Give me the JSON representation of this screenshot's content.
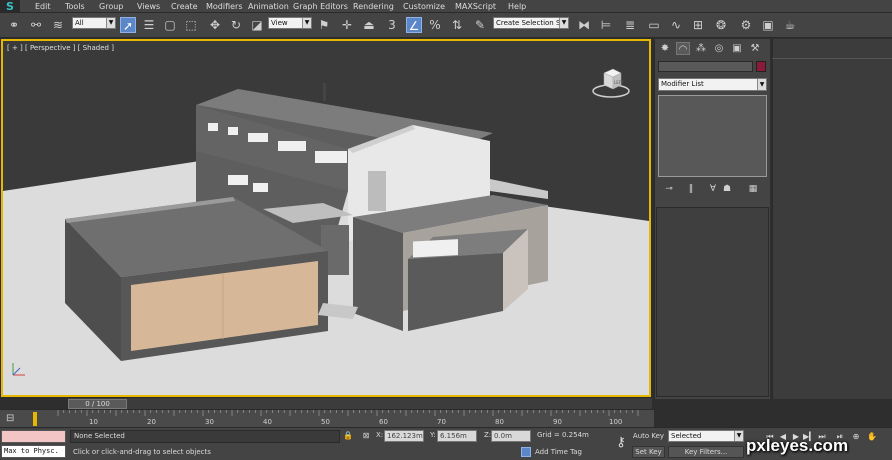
{
  "app": {
    "logo": "S",
    "menus": [
      "Edit",
      "Tools",
      "Group",
      "Views",
      "Create",
      "Modifiers",
      "Animation",
      "Graph Editors",
      "Rendering",
      "Customize",
      "MAXScript",
      "Help"
    ]
  },
  "toolbar": {
    "selection_filter": "All",
    "reference_coord": "View",
    "named_selection": "Create Selection Se",
    "snap_label": "3",
    "icons": [
      "link-icon",
      "unlink-icon",
      "bind-spacewarp-icon",
      "select-object-icon",
      "select-region-icon",
      "window-crossing-icon",
      "move-icon",
      "rotate-icon",
      "scale-icon",
      "pivot-icon",
      "manipulate-icon",
      "keyboard-shortcut-icon",
      "snap-toggle-icon",
      "angle-snap-icon",
      "percent-snap-icon",
      "spinner-snap-icon",
      "edit-named-selection-icon",
      "mirror-icon",
      "align-icon",
      "layer-explorer-icon",
      "toggle-ribbon-icon",
      "curve-editor-icon",
      "schematic-view-icon",
      "material-editor-icon",
      "render-setup-icon",
      "rendered-frame-icon",
      "render-icon"
    ]
  },
  "viewport": {
    "label": "[ + ] [ Perspective ] [ Shaded ]",
    "border_color": "#e6b800",
    "viewcube_label": "LEFT"
  },
  "command_panel": {
    "tabs": [
      "create-tab-icon",
      "modify-tab-icon",
      "hierarchy-tab-icon",
      "motion-tab-icon",
      "display-tab-icon",
      "utilities-tab-icon"
    ],
    "object_color": "#8b1a3a",
    "modifier_list": "Modifier List"
  },
  "timeline": {
    "frame_display": "0 / 100",
    "ticks": [
      "10",
      "20",
      "30",
      "40",
      "50",
      "60",
      "70",
      "80",
      "90",
      "100"
    ]
  },
  "status": {
    "maxscript_label": "Max to Physc.",
    "selection": "None Selected",
    "prompt": "Click or click-and-drag to select objects",
    "x_label": "X:",
    "x_value": "162.123m",
    "y_label": "Y:",
    "y_value": "6.156m",
    "z_label": "Z:",
    "z_value": "0.0m",
    "grid": "Grid = 0.254m",
    "add_time_tag": "Add Time Tag",
    "auto_key": "Auto Key",
    "set_key": "Set Key",
    "key_mode": "Selected",
    "key_filters": "Key Filters..."
  },
  "watermark": "pxleyes.com"
}
